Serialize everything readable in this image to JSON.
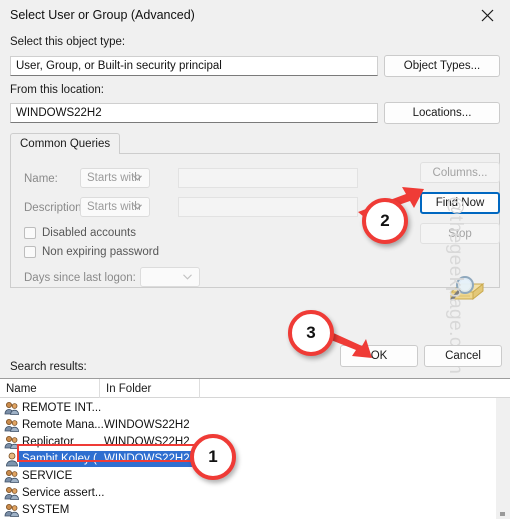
{
  "window": {
    "title": "Select User or Group (Advanced)",
    "close_icon": "close-icon"
  },
  "object_type": {
    "label": "Select this object type:",
    "value": "User, Group, or Built-in security principal",
    "button": "Object Types..."
  },
  "location": {
    "label": "From this location:",
    "value": "WINDOWS22H2",
    "button": "Locations..."
  },
  "tabs": [
    {
      "label": "Common Queries",
      "active": true
    }
  ],
  "queries": {
    "name_label": "Name:",
    "name_operator": "Starts with",
    "name_value": "",
    "description_label": "Description:",
    "description_operator": "Starts with",
    "description_value": "",
    "disabled_accounts": "Disabled accounts",
    "non_expiring_password": "Non expiring password",
    "days_label": "Days since last logon:",
    "days_value": ""
  },
  "side_buttons": {
    "columns": "Columns...",
    "find_now": "Find Now",
    "stop": "Stop"
  },
  "search_icon": "search-folder-icon",
  "footer": {
    "ok": "OK",
    "cancel": "Cancel"
  },
  "results": {
    "label": "Search results:",
    "columns": [
      "Name",
      "In Folder",
      ""
    ],
    "rows": [
      {
        "name": "REMOTE INT...",
        "folder": "",
        "icon": "group-icon",
        "selected": false
      },
      {
        "name": "Remote Mana...",
        "folder": "WINDOWS22H2",
        "icon": "group-icon",
        "selected": false
      },
      {
        "name": "Replicator",
        "folder": "WINDOWS22H2",
        "icon": "group-icon",
        "selected": false
      },
      {
        "name": "Sambit Koley (...",
        "folder": "WINDOWS22H2",
        "icon": "user-icon",
        "selected": true
      },
      {
        "name": "SERVICE",
        "folder": "",
        "icon": "group-icon",
        "selected": false
      },
      {
        "name": "Service assert...",
        "folder": "",
        "icon": "group-icon",
        "selected": false
      },
      {
        "name": "SYSTEM",
        "folder": "",
        "icon": "group-icon",
        "selected": false
      }
    ]
  },
  "annotations": {
    "step1": "1",
    "step2": "2",
    "step3": "3",
    "accent": "#ef3b36"
  },
  "watermark": "@thegeekpage.com"
}
